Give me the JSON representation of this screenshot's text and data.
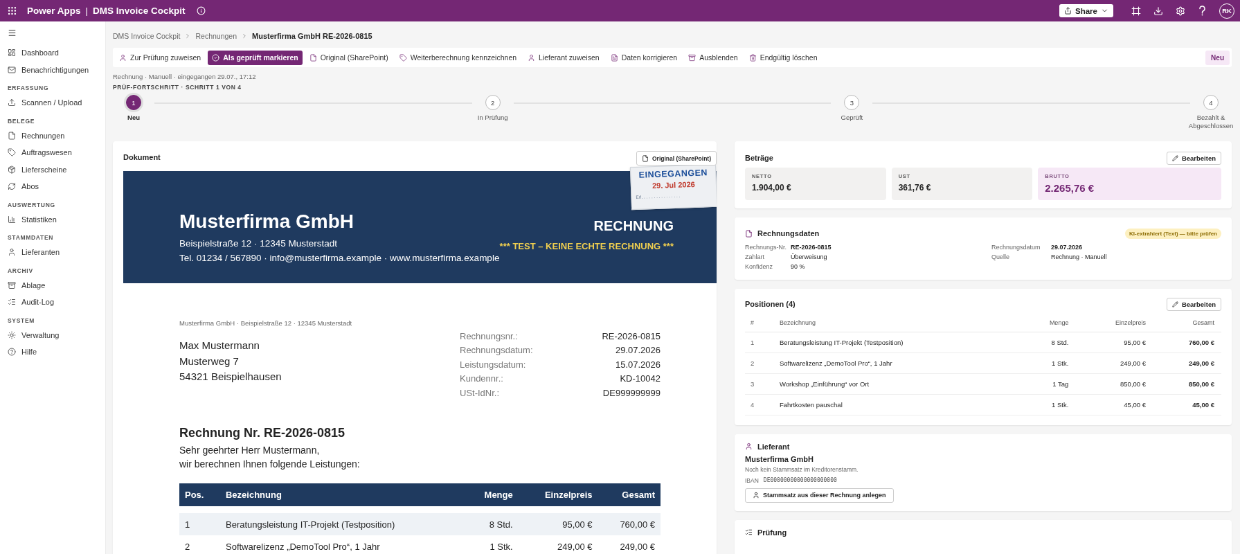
{
  "app_bar": {
    "app_name": "Power Apps",
    "separator": "|",
    "title": "DMS Invoice Cockpit",
    "share": "Share",
    "avatar": "RK"
  },
  "sidebar": {
    "sections": [
      {
        "items": [
          {
            "label": "Dashboard",
            "selected": false
          },
          {
            "label": "Benachrichtigungen",
            "selected": false
          }
        ]
      },
      {
        "heading": "ERFASSUNG",
        "items": [
          {
            "label": "Scannen / Upload",
            "selected": false
          }
        ]
      },
      {
        "heading": "BELEGE",
        "items": [
          {
            "label": "Rechnungen",
            "selected": false
          },
          {
            "label": "Auftragswesen",
            "selected": false
          },
          {
            "label": "Lieferscheine",
            "selected": false
          },
          {
            "label": "Abos",
            "selected": false
          }
        ]
      },
      {
        "heading": "AUSWERTUNG",
        "items": [
          {
            "label": "Statistiken",
            "selected": false
          }
        ]
      },
      {
        "heading": "STAMMDATEN",
        "items": [
          {
            "label": "Lieferanten",
            "selected": false
          }
        ]
      },
      {
        "heading": "ARCHIV",
        "items": [
          {
            "label": "Ablage",
            "selected": false
          },
          {
            "label": "Audit-Log",
            "selected": false
          }
        ]
      },
      {
        "heading": "SYSTEM",
        "items": [
          {
            "label": "Verwaltung",
            "selected": false
          },
          {
            "label": "Hilfe",
            "selected": false
          }
        ]
      }
    ]
  },
  "breadcrumb": [
    "DMS Invoice Cockpit",
    "Rechnungen",
    "Musterfirma GmbH RE-2026-0815"
  ],
  "toolbar": {
    "actions": [
      {
        "label": "Zur Prüfung zuweisen",
        "primary": false
      },
      {
        "label": "Als geprüft markieren",
        "primary": true
      },
      {
        "label": "Original (SharePoint)",
        "primary": false
      },
      {
        "label": "Weiterberechnung kennzeichnen",
        "primary": false
      },
      {
        "label": "Lieferant zuweisen",
        "primary": false
      },
      {
        "label": "Daten korrigieren",
        "primary": false
      },
      {
        "label": "Ausblenden",
        "primary": false
      },
      {
        "label": "Endgültig löschen",
        "primary": false
      }
    ],
    "status": "Neu"
  },
  "meta": "Rechnung · Manuell · eingegangen 29.07., 17:12",
  "progress": {
    "heading": "PRÜF-FORTSCHRITT · SCHRITT 1 VON 4",
    "steps": [
      {
        "number": "1",
        "label": "Neu",
        "selected": true
      },
      {
        "number": "2",
        "label": "In Prüfung",
        "selected": false
      },
      {
        "number": "3",
        "label": "Geprüft",
        "selected": false
      },
      {
        "number": "4",
        "label": "Bezahlt & Abgeschlossen",
        "selected": false
      }
    ]
  },
  "document": {
    "title": "Dokument",
    "original_button": "Original (SharePoint)",
    "stamp": {
      "title": "EINGEGANGEN",
      "date": "29. Jul 2026",
      "note": "Erl. . . . . . . . . . . . . . . ."
    },
    "company": "Musterfirma GmbH",
    "address": "Beispielstraße 12 · 12345 Musterstadt",
    "contact": "Tel. 01234 / 567890 · info@musterfirma.example · www.musterfirma.example",
    "doc_type": "RECHNUNG",
    "test_notice": "*** TEST – KEINE ECHTE RECHNUNG ***",
    "sender_line": "Musterfirma GmbH · Beispielstraße 12 · 12345 Musterstadt",
    "recipient": [
      "Max Mustermann",
      "Musterweg 7",
      "54321 Beispielhausen"
    ],
    "info": [
      {
        "label": "Rechnungsnr.:",
        "value": "RE-2026-0815"
      },
      {
        "label": "Rechnungsdatum:",
        "value": "29.07.2026"
      },
      {
        "label": "Leistungsdatum:",
        "value": "15.07.2026"
      },
      {
        "label": "Kundennr.:",
        "value": "KD-10042"
      },
      {
        "label": "USt-IdNr.:",
        "value": "DE999999999"
      }
    ],
    "heading": "Rechnung Nr. RE-2026-0815",
    "greeting": [
      "Sehr geehrter Herr Mustermann,",
      "wir berechnen Ihnen folgende Leistungen:"
    ],
    "table": {
      "columns": [
        "Pos.",
        "Bezeichnung",
        "Menge",
        "Einzelpreis",
        "Gesamt"
      ],
      "rows": [
        [
          "1",
          "Beratungsleistung IT-Projekt (Testposition)",
          "8 Std.",
          "95,00 €",
          "760,00 €"
        ],
        [
          "2",
          "Softwarelizenz „DemoTool Pro“, 1 Jahr",
          "1 Stk.",
          "249,00 €",
          "249,00 €"
        ]
      ]
    }
  },
  "amounts": {
    "title": "Beträge",
    "edit": "Bearbeiten",
    "tiles": [
      {
        "label": "NETTO",
        "value": "1.904,00 €",
        "emphasis": false
      },
      {
        "label": "UST",
        "value": "361,76 €",
        "emphasis": false
      },
      {
        "label": "BRUTTO",
        "value": "2.265,76 €",
        "emphasis": true
      }
    ]
  },
  "invoice_data": {
    "title": "Rechnungsdaten",
    "badge": "KI-extrahiert (Text) — bitte prüfen",
    "left_fields": [
      {
        "label": "Rechnungs-Nr.",
        "value": "RE-2026-0815",
        "bold": true
      },
      {
        "label": "Zahlart",
        "value": "Überweisung",
        "bold": false
      },
      {
        "label": "Konfidenz",
        "value": "90 %",
        "bold": false
      }
    ],
    "right_fields": [
      {
        "label": "Rechnungsdatum",
        "value": "29.07.2026",
        "bold": true
      },
      {
        "label": "Quelle",
        "value": "Rechnung · Manuell",
        "bold": false
      }
    ]
  },
  "positions": {
    "title": "Positionen (4)",
    "edit": "Bearbeiten",
    "columns": [
      "#",
      "Bezeichnung",
      "Menge",
      "Einzelpreis",
      "Gesamt"
    ],
    "rows": [
      [
        "1",
        "Beratungsleistung IT-Projekt (Testposition)",
        "8 Std.",
        "95,00 €",
        "760,00 €"
      ],
      [
        "2",
        "Softwarelizenz „DemoTool Pro“, 1 Jahr",
        "1 Stk.",
        "249,00 €",
        "249,00 €"
      ],
      [
        "3",
        "Workshop „Einführung“ vor Ort",
        "1 Tag",
        "850,00 €",
        "850,00 €"
      ],
      [
        "4",
        "Fahrtkosten pauschal",
        "1 Stk.",
        "45,00 €",
        "45,00 €"
      ]
    ]
  },
  "supplier": {
    "title": "Lieferant",
    "name": "Musterfirma GmbH",
    "note": "Noch kein Stammsatz im Kreditorenstamm.",
    "iban_label": "IBAN",
    "iban": "DE00000000000000000000",
    "button": "Stammsatz aus dieser Rechnung anlegen"
  },
  "review": {
    "title": "Prüfung"
  }
}
